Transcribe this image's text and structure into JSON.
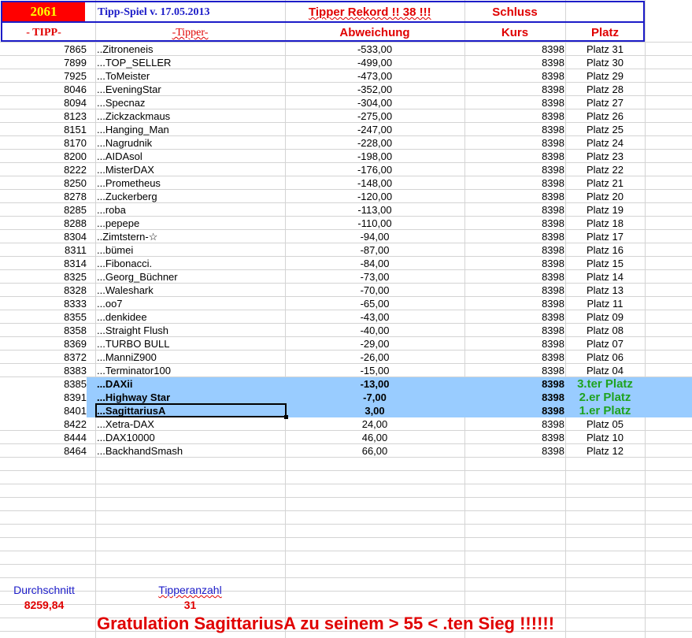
{
  "header": {
    "year": "2061",
    "title": "Tipp-Spiel v. 17.05.2013",
    "record": "Tipper Rekord !!  38  !!!",
    "schluss": "Schluss",
    "col_tipp": "- TIPP-",
    "col_tipper": "-Tipper-",
    "col_abw": "Abweichung",
    "col_kurs": "Kurs",
    "col_platz": "Platz"
  },
  "rows": [
    {
      "tipp": "7865",
      "name": "..Zitroneneis",
      "abw": "-533,00",
      "kurs": "8398",
      "platz": "Platz 31"
    },
    {
      "tipp": "7899",
      "name": "...TOP_SELLER",
      "abw": "-499,00",
      "kurs": "8398",
      "platz": "Platz 30"
    },
    {
      "tipp": "7925",
      "name": "...ToMeister",
      "abw": "-473,00",
      "kurs": "8398",
      "platz": "Platz 29"
    },
    {
      "tipp": "8046",
      "name": "...EveningStar",
      "abw": "-352,00",
      "kurs": "8398",
      "platz": "Platz 28"
    },
    {
      "tipp": "8094",
      "name": "...Specnaz",
      "abw": "-304,00",
      "kurs": "8398",
      "platz": "Platz 27"
    },
    {
      "tipp": "8123",
      "name": "...Zickzackmaus",
      "abw": "-275,00",
      "kurs": "8398",
      "platz": "Platz 26"
    },
    {
      "tipp": "8151",
      "name": "...Hanging_Man",
      "abw": "-247,00",
      "kurs": "8398",
      "platz": "Platz 25"
    },
    {
      "tipp": "8170",
      "name": "...Nagrudnik",
      "abw": "-228,00",
      "kurs": "8398",
      "platz": "Platz 24"
    },
    {
      "tipp": "8200",
      "name": "...AIDAsol",
      "abw": "-198,00",
      "kurs": "8398",
      "platz": "Platz 23"
    },
    {
      "tipp": "8222",
      "name": "...MisterDAX",
      "abw": "-176,00",
      "kurs": "8398",
      "platz": "Platz 22"
    },
    {
      "tipp": "8250",
      "name": "...Prometheus",
      "abw": "-148,00",
      "kurs": "8398",
      "platz": "Platz 21"
    },
    {
      "tipp": "8278",
      "name": "...Zuckerberg",
      "abw": "-120,00",
      "kurs": "8398",
      "platz": "Platz 20"
    },
    {
      "tipp": "8285",
      "name": "...roba",
      "abw": "-113,00",
      "kurs": "8398",
      "platz": "Platz 19"
    },
    {
      "tipp": "8288",
      "name": "...pepepe",
      "abw": "-110,00",
      "kurs": "8398",
      "platz": "Platz 18"
    },
    {
      "tipp": "8304",
      "name": "..Zimtstern-☆",
      "abw": "-94,00",
      "kurs": "8398",
      "platz": "Platz 17"
    },
    {
      "tipp": "8311",
      "name": "...bümei",
      "abw": "-87,00",
      "kurs": "8398",
      "platz": "Platz 16"
    },
    {
      "tipp": "8314",
      "name": "...Fibonacci.",
      "abw": "-84,00",
      "kurs": "8398",
      "platz": "Platz 15"
    },
    {
      "tipp": "8325",
      "name": "...Georg_Büchner",
      "abw": "-73,00",
      "kurs": "8398",
      "platz": "Platz 14"
    },
    {
      "tipp": "8328",
      "name": "...Waleshark",
      "abw": "-70,00",
      "kurs": "8398",
      "platz": "Platz 13"
    },
    {
      "tipp": "8333",
      "name": "...oo7",
      "abw": "-65,00",
      "kurs": "8398",
      "platz": "Platz 11"
    },
    {
      "tipp": "8355",
      "name": "...denkidee",
      "abw": "-43,00",
      "kurs": "8398",
      "platz": "Platz 09"
    },
    {
      "tipp": "8358",
      "name": "...Straight Flush",
      "abw": "-40,00",
      "kurs": "8398",
      "platz": "Platz 08"
    },
    {
      "tipp": "8369",
      "name": "...TURBO BULL",
      "abw": "-29,00",
      "kurs": "8398",
      "platz": "Platz 07"
    },
    {
      "tipp": "8372",
      "name": "...ManniZ900",
      "abw": "-26,00",
      "kurs": "8398",
      "platz": "Platz 06"
    },
    {
      "tipp": "8383",
      "name": "...Terminator100",
      "abw": "-15,00",
      "kurs": "8398",
      "platz": "Platz 04"
    },
    {
      "tipp": "8385",
      "name": "...DAXii",
      "abw": "-13,00",
      "kurs": "8398",
      "platz": "3.ter Platz",
      "highlight": true
    },
    {
      "tipp": "8391",
      "name": "...Highway Star",
      "abw": "-7,00",
      "kurs": "8398",
      "platz": "2.er Platz",
      "highlight": true
    },
    {
      "tipp": "8401",
      "name": "...SagittariusA",
      "abw": "3,00",
      "kurs": "8398",
      "platz": "1.er Platz",
      "highlight": true
    },
    {
      "tipp": "8422",
      "name": "...Xetra-DAX",
      "abw": "24,00",
      "kurs": "8398",
      "platz": "Platz 05"
    },
    {
      "tipp": "8444",
      "name": "...DAX10000",
      "abw": "46,00",
      "kurs": "8398",
      "platz": "Platz 10"
    },
    {
      "tipp": "8464",
      "name": "...BackhandSmash",
      "abw": "66,00",
      "kurs": "8398",
      "platz": "Platz 12"
    }
  ],
  "footer": {
    "avg_label": "Durchschnitt",
    "avg_value": "8259,84",
    "count_label": "Tipperanzahl",
    "count_value": "31",
    "congrats": "Gratulation SagittariusA  zu seinem > 55 < .ten Sieg !!!!!!"
  },
  "colors": {
    "header_border": "#1c1cc8",
    "year_bg": "#ff0000",
    "year_text": "#ffff00",
    "highlight": "#99ccff",
    "winner_text": "#1fa31f",
    "red_text": "#e00000"
  }
}
